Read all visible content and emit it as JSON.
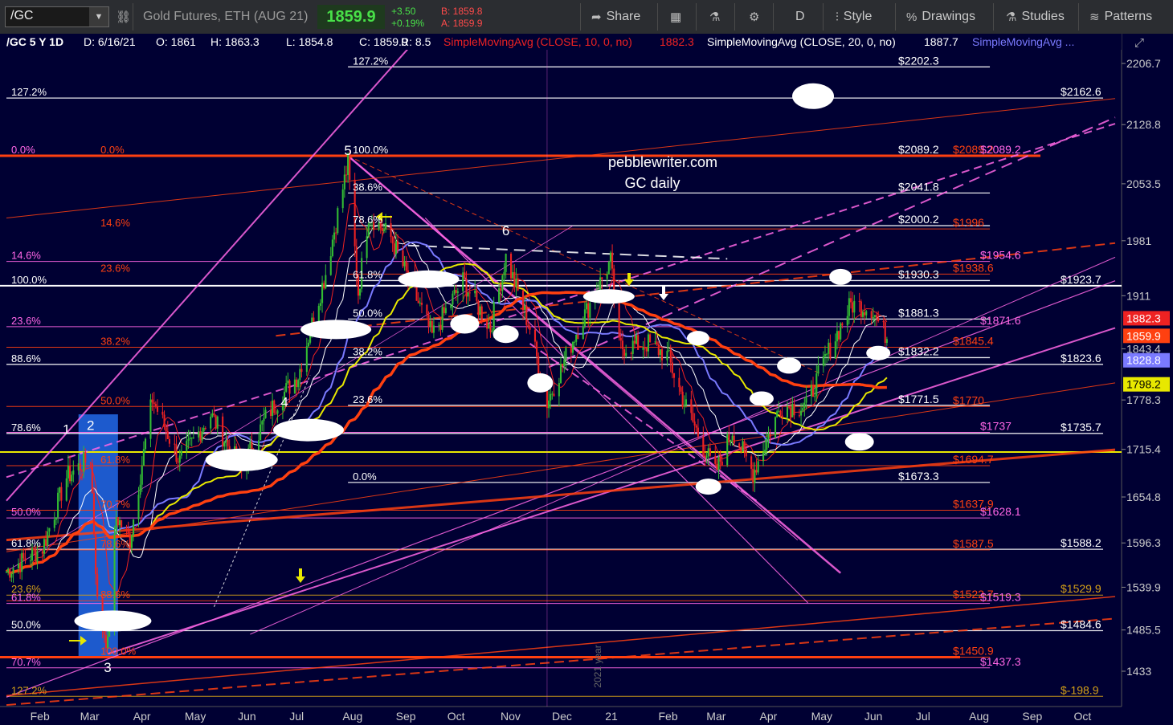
{
  "toolbar": {
    "symbol": "/GC",
    "description": "Gold Futures, ETH (AUG 21)",
    "last": "1859.9",
    "change": "+3.50",
    "change_pct": "+0.19%",
    "bid": "B: 1859.8",
    "ask": "A: 1859.9",
    "share": "Share",
    "period": "D",
    "style": "Style",
    "drawings": "Drawings",
    "studies": "Studies",
    "patterns": "Patterns"
  },
  "header": {
    "symbol": "/GC 5 Y 1D",
    "date": "D: 6/16/21",
    "open": "O: 1861",
    "high": "H: 1863.3",
    "low": "L: 1854.8",
    "close": "C: 1859.9",
    "range": "R: 8.5",
    "sma10": "SimpleMovingAvg (CLOSE, 10, 0, no)",
    "sma10_val": "1882.3",
    "sma20": "SimpleMovingAvg (CLOSE, 20, 0, no)",
    "sma20_val": "1887.7",
    "sma3": "SimpleMovingAvg ..."
  },
  "colors": {
    "bg": "#000033",
    "white": "#ffffff",
    "pink": "#ff66e6",
    "orange": "#ff4010",
    "yellow": "#e8e800",
    "blue": "#7a7aff",
    "green": "#33bb33",
    "red": "#ee2222",
    "gold": "#d4a017"
  },
  "chart_data": {
    "type": "candlestick",
    "watermark_1": "pebblewriter.com",
    "watermark_2": "GC daily",
    "year_marker": "2021 year",
    "ylim": [
      1400,
      2230
    ],
    "x_labels": [
      "Feb",
      "Mar",
      "Apr",
      "May",
      "Jun",
      "Jul",
      "Aug",
      "Sep",
      "Oct",
      "Nov",
      "Dec",
      "21",
      "Feb",
      "Mar",
      "Apr",
      "May",
      "Jun",
      "Jul",
      "Aug",
      "Sep",
      "Oct"
    ],
    "y_ticks": [
      {
        "label": "2206.7",
        "value": 2206.7
      },
      {
        "label": "2128.8",
        "value": 2128.8
      },
      {
        "label": "2053.5",
        "value": 2053.5
      },
      {
        "label": "1981",
        "value": 1981
      },
      {
        "label": "1911",
        "value": 1911
      },
      {
        "label": "1843.4",
        "value": 1843.4
      },
      {
        "label": "1778.3",
        "value": 1778.3
      },
      {
        "label": "1715.4",
        "value": 1715.4
      },
      {
        "label": "1654.8",
        "value": 1654.8
      },
      {
        "label": "1596.3",
        "value": 1596.3
      },
      {
        "label": "1539.9",
        "value": 1539.9
      },
      {
        "label": "1485.5",
        "value": 1485.5
      },
      {
        "label": "1433",
        "value": 1433
      }
    ],
    "price_badges": [
      {
        "label": "1882.3",
        "value": 1882.3,
        "color": "#ee2222",
        "text": "#fff"
      },
      {
        "label": "1859.9",
        "value": 1859.9,
        "color": "#ff4010",
        "text": "#fff"
      },
      {
        "label": "1828.8",
        "value": 1828.8,
        "color": "#7a7aff",
        "text": "#fff"
      },
      {
        "label": "1798.2",
        "value": 1798.2,
        "color": "#e8e800",
        "text": "#000"
      }
    ],
    "wave_labels": [
      {
        "text": "1",
        "x": "2020-02-24",
        "y": 1735
      },
      {
        "text": "2",
        "x": "2020-03-09",
        "y": 1740
      },
      {
        "text": "3",
        "x": "2020-03-19",
        "y": 1432
      },
      {
        "text": "4",
        "x": "2020-06-30",
        "y": 1770
      },
      {
        "text": "5",
        "x": "2020-08-06",
        "y": 2090
      },
      {
        "text": "6",
        "x": "2020-11-06",
        "y": 1988
      }
    ],
    "levels": [
      {
        "price": 2202.3,
        "label": "$2202.3",
        "color": "#ffffff",
        "x0": "2020-08-06",
        "x1": "2021-08-15"
      },
      {
        "price": 2162.6,
        "label": "$2162.6",
        "color": "#ffffff",
        "x0": "2020-01-20",
        "x1": "2021-10-20"
      },
      {
        "price": 2089.2,
        "label": "$2089.2",
        "color": "#ffffff",
        "x0": "2020-08-06",
        "x1": "2021-08-15"
      },
      {
        "price": 2089.2,
        "label": "$2089.2",
        "color": "#ff4010",
        "x0": "2020-01-20",
        "x1": "2021-08-20"
      },
      {
        "price": 2089.2,
        "label": "$2089.2",
        "color": "#ff66e6",
        "x0": "2020-01-20",
        "x1": "2021-08-20"
      },
      {
        "price": 2041.8,
        "label": "$2041.8",
        "color": "#ffffff",
        "x0": "2020-08-06",
        "x1": "2021-08-15"
      },
      {
        "price": 2000.2,
        "label": "$2000.2",
        "color": "#ffffff",
        "x0": "2020-08-06",
        "x1": "2021-08-15"
      },
      {
        "price": 1996,
        "label": "$1996",
        "color": "#ff4010",
        "x0": "2020-08-06",
        "x1": "2021-08-15"
      },
      {
        "price": 1954.6,
        "label": "$1954.6",
        "color": "#ff66e6",
        "x0": "2020-01-20",
        "x1": "2021-08-15"
      },
      {
        "price": 1938.6,
        "label": "$1938.6",
        "color": "#ff4010",
        "x0": "2020-08-06",
        "x1": "2021-08-15"
      },
      {
        "price": 1930.3,
        "label": "$1930.3",
        "color": "#ffffff",
        "x0": "2020-08-06",
        "x1": "2021-08-15"
      },
      {
        "price": 1923.7,
        "label": "$1923.7",
        "color": "#ffffff",
        "x0": "2020-01-20",
        "x1": "2021-10-20"
      },
      {
        "price": 1881.3,
        "label": "$1881.3",
        "color": "#ffffff",
        "x0": "2020-08-06",
        "x1": "2021-08-15"
      },
      {
        "price": 1871.6,
        "label": "$1871.6",
        "color": "#ff66e6",
        "x0": "2020-01-20",
        "x1": "2021-08-15"
      },
      {
        "price": 1845.4,
        "label": "$1845.4",
        "color": "#ff4010",
        "x0": "2020-01-20",
        "x1": "2021-08-15"
      },
      {
        "price": 1832.2,
        "label": "$1832.2",
        "color": "#ffffff",
        "x0": "2020-08-06",
        "x1": "2021-08-15"
      },
      {
        "price": 1823.6,
        "label": "$1823.6",
        "color": "#ffffff",
        "x0": "2020-01-20",
        "x1": "2021-10-20"
      },
      {
        "price": 1771.5,
        "label": "$1771.5",
        "color": "#ffffff",
        "x0": "2020-08-06",
        "x1": "2021-08-15"
      },
      {
        "price": 1770,
        "label": "$1770",
        "color": "#ff4010",
        "x0": "2020-01-20",
        "x1": "2021-08-15"
      },
      {
        "price": 1737,
        "label": "$1737",
        "color": "#ff66e6",
        "x0": "2020-01-20",
        "x1": "2021-08-15"
      },
      {
        "price": 1735.7,
        "label": "$1735.7",
        "color": "#ffffff",
        "x0": "2020-01-20",
        "x1": "2021-10-20"
      },
      {
        "price": 1694.7,
        "label": "$1694.7",
        "color": "#ff4010",
        "x0": "2020-01-20",
        "x1": "2021-08-15"
      },
      {
        "price": 1673.3,
        "label": "$1673.3",
        "color": "#ffffff",
        "x0": "2020-08-06",
        "x1": "2021-08-15"
      },
      {
        "price": 1637.9,
        "label": "$1637.9",
        "color": "#ff4010",
        "x0": "2020-01-20",
        "x1": "2021-08-15"
      },
      {
        "price": 1628.1,
        "label": "$1628.1",
        "color": "#ff66e6",
        "x0": "2020-01-20",
        "x1": "2021-08-15"
      },
      {
        "price": 1588.2,
        "label": "$1588.2",
        "color": "#ffffff",
        "x0": "2020-01-20",
        "x1": "2021-10-20"
      },
      {
        "price": 1587.5,
        "label": "$1587.5",
        "color": "#ff4010",
        "x0": "2020-01-20",
        "x1": "2021-08-15"
      },
      {
        "price": 1529.9,
        "label": "$1529.9",
        "color": "#d4a017",
        "x0": "2020-01-20",
        "x1": "2021-10-20"
      },
      {
        "price": 1522.7,
        "label": "$1522.7",
        "color": "#ff4010",
        "x0": "2020-01-20",
        "x1": "2021-08-15"
      },
      {
        "price": 1519.3,
        "label": "$1519.3",
        "color": "#ff66e6",
        "x0": "2020-01-20",
        "x1": "2021-08-15"
      },
      {
        "price": 1484.6,
        "label": "$1484.6",
        "color": "#ffffff",
        "x0": "2020-01-20",
        "x1": "2021-10-20"
      },
      {
        "price": 1450.9,
        "label": "$1450.9",
        "color": "#ff4010",
        "x0": "2020-01-20",
        "x1": "2021-08-15"
      },
      {
        "price": 1437.3,
        "label": "$1437.3",
        "color": "#ff66e6",
        "x0": "2020-01-20",
        "x1": "2021-08-15"
      },
      {
        "price": 1401,
        "label": "$-198.9",
        "color": "#d4a017",
        "x0": "2020-01-20",
        "x1": "2021-10-20"
      }
    ],
    "fib_labels": [
      {
        "text": "127.2%",
        "price": 2202.3,
        "x": "2020-08-06",
        "color": "#ffffff"
      },
      {
        "text": "127.2%",
        "price": 2162.6,
        "x": "2020-01-20",
        "color": "#ffffff"
      },
      {
        "text": "0.0%",
        "price": 2089.2,
        "x": "2020-01-20",
        "color": "#ff66e6"
      },
      {
        "text": "0.0%",
        "price": 2089.2,
        "x": "2020-03-12",
        "color": "#ff4010"
      },
      {
        "text": "100.0%",
        "price": 2089.2,
        "x": "2020-08-06",
        "color": "#ffffff"
      },
      {
        "text": "38.6%",
        "price": 2041.8,
        "x": "2020-08-06",
        "color": "#ffffff"
      },
      {
        "text": "78.6%",
        "price": 2000.2,
        "x": "2020-08-06",
        "color": "#ffffff"
      },
      {
        "text": "14.6%",
        "price": 1996,
        "x": "2020-03-12",
        "color": "#ff4010"
      },
      {
        "text": "14.6%",
        "price": 1954.6,
        "x": "2020-01-20",
        "color": "#ff66e6"
      },
      {
        "text": "23.6%",
        "price": 1938.6,
        "x": "2020-03-12",
        "color": "#ff4010"
      },
      {
        "text": "61.8%",
        "price": 1930.3,
        "x": "2020-08-06",
        "color": "#ffffff"
      },
      {
        "text": "100.0%",
        "price": 1923.7,
        "x": "2020-01-20",
        "color": "#ffffff"
      },
      {
        "text": "50.0%",
        "price": 1881.3,
        "x": "2020-08-06",
        "color": "#ffffff"
      },
      {
        "text": "23.6%",
        "price": 1871.6,
        "x": "2020-01-20",
        "color": "#ff66e6"
      },
      {
        "text": "38.2%",
        "price": 1845.4,
        "x": "2020-03-12",
        "color": "#ff4010"
      },
      {
        "text": "38.2%",
        "price": 1832.2,
        "x": "2020-08-06",
        "color": "#ffffff"
      },
      {
        "text": "88.6%",
        "price": 1823.6,
        "x": "2020-01-20",
        "color": "#ffffff"
      },
      {
        "text": "23.6%",
        "price": 1771.5,
        "x": "2020-08-06",
        "color": "#ffffff"
      },
      {
        "text": "50.0%",
        "price": 1770,
        "x": "2020-03-12",
        "color": "#ff4010"
      },
      {
        "text": "78.6%",
        "price": 1735.7,
        "x": "2020-01-20",
        "color": "#ffffff"
      },
      {
        "text": "61.8%",
        "price": 1694.7,
        "x": "2020-03-12",
        "color": "#ff4010"
      },
      {
        "text": "0.0%",
        "price": 1673.3,
        "x": "2020-08-06",
        "color": "#ffffff"
      },
      {
        "text": "70.7%",
        "price": 1637.9,
        "x": "2020-03-12",
        "color": "#ff4010"
      },
      {
        "text": "50.0%",
        "price": 1628.1,
        "x": "2020-01-20",
        "color": "#ff66e6"
      },
      {
        "text": "61.8%",
        "price": 1588.2,
        "x": "2020-01-20",
        "color": "#ffffff"
      },
      {
        "text": "78.6%",
        "price": 1587.5,
        "x": "2020-03-12",
        "color": "#ff4010"
      },
      {
        "text": "23.6%",
        "price": 1529.9,
        "x": "2020-01-20",
        "color": "#d4a017"
      },
      {
        "text": "88.6%",
        "price": 1522.7,
        "x": "2020-03-12",
        "color": "#ff4010"
      },
      {
        "text": "61.8%",
        "price": 1519.3,
        "x": "2020-01-20",
        "color": "#ff66e6"
      },
      {
        "text": "50.0%",
        "price": 1484.6,
        "x": "2020-01-20",
        "color": "#ffffff"
      },
      {
        "text": "100.0%",
        "price": 1450.9,
        "x": "2020-03-12",
        "color": "#ff4010"
      },
      {
        "text": "70.7%",
        "price": 1437.3,
        "x": "2020-01-20",
        "color": "#ff66e6"
      },
      {
        "text": "127.2%",
        "price": 1401,
        "x": "2020-01-20",
        "color": "#d4a017"
      }
    ]
  }
}
